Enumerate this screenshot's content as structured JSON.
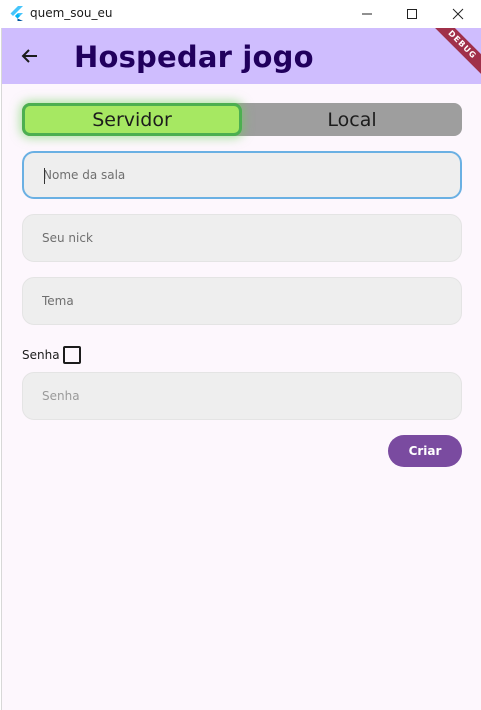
{
  "window": {
    "title": "quem_sou_eu",
    "app_icon": "flutter-icon",
    "controls": [
      "minimize-icon",
      "maximize-icon",
      "close-icon"
    ]
  },
  "appbar": {
    "title": "Hospedar jogo",
    "back_icon": "arrow-left-icon",
    "background": "#cfbdfe",
    "title_color": "#21005d"
  },
  "debug_banner": "DEBUG",
  "toggle": {
    "options": [
      "Servidor",
      "Local"
    ],
    "selected": "Servidor",
    "selected_color": "#a6e862",
    "unselected_color": "#9e9e9e"
  },
  "form": {
    "room_name_placeholder": "Nome da sala",
    "nick_placeholder": "Seu nick",
    "theme_placeholder": "Tema",
    "password_label": "Senha",
    "password_checked": false,
    "password_placeholder": "Senha",
    "create_label": "Criar",
    "create_color": "#7a4ba0"
  }
}
